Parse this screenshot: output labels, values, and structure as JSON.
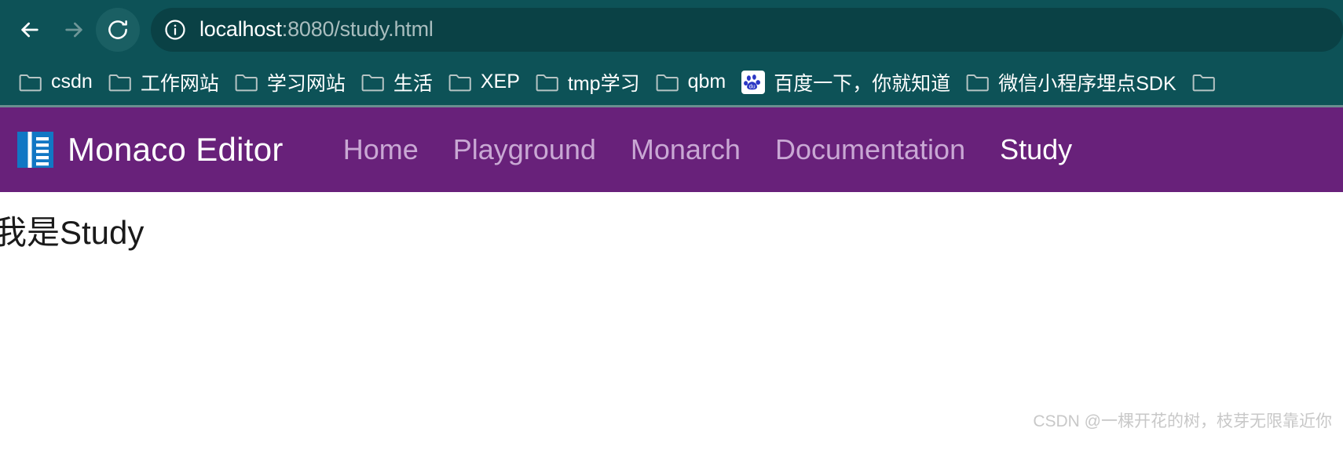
{
  "browser": {
    "back_icon": "arrow-left-icon",
    "forward_icon": "arrow-right-icon",
    "reload_icon": "reload-icon",
    "site_info_icon": "info-circle-icon",
    "url_host": "localhost",
    "url_rest": ":8080/study.html",
    "url_full": "localhost:8080/study.html",
    "toolbar_color": "#0d5257",
    "url_pill_color": "#0a4145"
  },
  "bookmarks": {
    "items": [
      {
        "label": "csdn",
        "icon": "folder-icon"
      },
      {
        "label": "工作网站",
        "icon": "folder-icon"
      },
      {
        "label": "学习网站",
        "icon": "folder-icon"
      },
      {
        "label": "生活",
        "icon": "folder-icon"
      },
      {
        "label": "XEP",
        "icon": "folder-icon"
      },
      {
        "label": "tmp学习",
        "icon": "folder-icon"
      },
      {
        "label": "qbm",
        "icon": "folder-icon"
      },
      {
        "label": "百度一下，你就知道",
        "icon": "baidu-favicon"
      },
      {
        "label": "微信小程序埋点SDK",
        "icon": "folder-icon"
      },
      {
        "label": "",
        "icon": "folder-icon"
      }
    ]
  },
  "site": {
    "brand": "Monaco Editor",
    "brand_logo_icon": "monaco-logo-icon",
    "navbar_color": "#68217a",
    "nav_links": [
      {
        "label": "Home",
        "active": false
      },
      {
        "label": "Playground",
        "active": false
      },
      {
        "label": "Monarch",
        "active": false
      },
      {
        "label": "Documentation",
        "active": false
      },
      {
        "label": "Study",
        "active": true
      }
    ]
  },
  "content": {
    "heading": "我是Study",
    "watermark": "CSDN @一棵开花的树，枝芽无限靠近你"
  }
}
